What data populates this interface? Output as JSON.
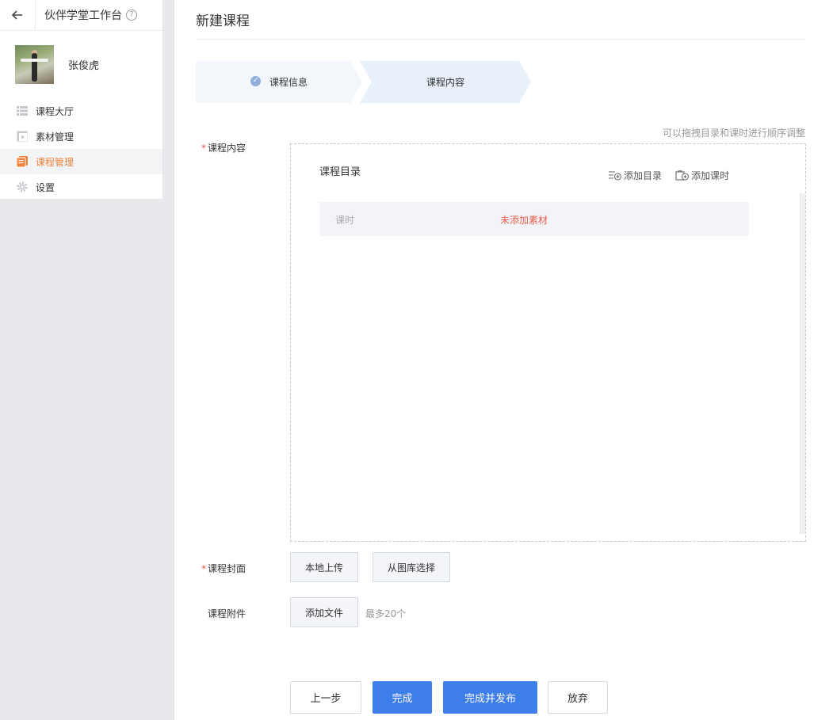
{
  "sidebar": {
    "app_title": "伙伴学堂工作台",
    "username": "张俊虎",
    "items": [
      {
        "label": "课程大厅",
        "icon": "list-icon",
        "active": false
      },
      {
        "label": "素材管理",
        "icon": "media-icon",
        "active": false
      },
      {
        "label": "课程管理",
        "icon": "course-icon",
        "active": true
      },
      {
        "label": "设置",
        "icon": "gear-icon",
        "active": false
      }
    ]
  },
  "main": {
    "page_title": "新建课程",
    "steps": [
      {
        "label": "课程信息",
        "done": true
      },
      {
        "label": "课程内容",
        "done": false
      }
    ],
    "drag_hint": "可以拖拽目录和课时进行顺序调整",
    "content_label": "课程内容",
    "catalog": {
      "title": "课程目录",
      "add_dir": "添加目录",
      "add_lesson": "添加课时",
      "lesson_label": "课时",
      "lesson_status": "未添加素材"
    },
    "cover": {
      "label": "课程封面",
      "local_upload": "本地上传",
      "from_gallery": "从图库选择"
    },
    "attachment": {
      "label": "课程附件",
      "add_file": "添加文件",
      "hint": "最多20个"
    },
    "footer": {
      "prev": "上一步",
      "finish": "完成",
      "finish_publish": "完成并发布",
      "abandon": "放弃"
    }
  },
  "colors": {
    "accent_orange": "#f0823d",
    "primary_blue": "#3e7ee8",
    "warning_red": "#e95e4d"
  }
}
